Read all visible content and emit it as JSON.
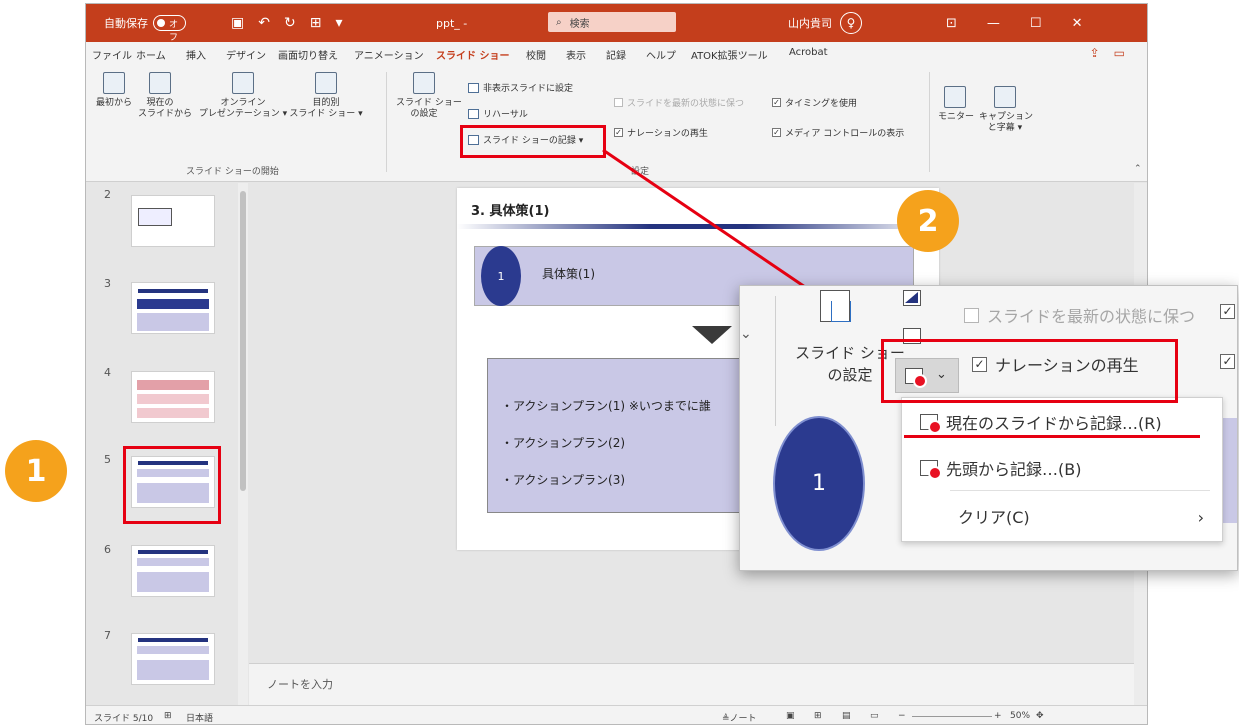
{
  "titlebar": {
    "autosave_label": "自動保存",
    "autosave_state": "オフ",
    "filename": "ppt_ -",
    "search_placeholder": "検索",
    "username": "山内貴司",
    "avatar_glyph": "♀"
  },
  "tabs": [
    "ファイル",
    "ホーム",
    "挿入",
    "デザイン",
    "画面切り替え",
    "アニメーション",
    "スライド ショー",
    "校閲",
    "表示",
    "記録",
    "ヘルプ",
    "ATOK拡張ツール",
    "Acrobat"
  ],
  "active_tab": "スライド ショー",
  "ribbon": {
    "from_start": "最初から",
    "from_current_1": "現在の",
    "from_current_2": "スライドから",
    "online_1": "オンライン",
    "online_2": "プレゼンテーション ▾",
    "custom_1": "目的別",
    "custom_2": "スライド ショー ▾",
    "group_start": "スライド ショーの開始",
    "setup_1": "スライド ショー",
    "setup_2": "の設定",
    "hide_slide": "非表示スライドに設定",
    "rehearse": "リハーサル",
    "record": "スライド ショーの記録 ▾",
    "keep_updated": "スライドを最新の状態に保つ",
    "play_narration": "ナレーションの再生",
    "use_timings": "タイミングを使用",
    "show_media": "メディア コントロールの表示",
    "group_setup": "設定",
    "monitor": "モニター",
    "captions_1": "キャプション",
    "captions_2": "と字幕 ▾"
  },
  "thumbnails": {
    "numbers": [
      "2",
      "3",
      "4",
      "5",
      "6",
      "7"
    ],
    "selected": "5"
  },
  "slide": {
    "title": "3. 具体策(1)",
    "circle_number": "1",
    "bar_text": "具体策(1)",
    "action_items": [
      "・アクションプラン(1)  ※いつまでに誰",
      "・アクションプラン(2)",
      "・アクションプラン(3)"
    ]
  },
  "notes_placeholder": "ノートを入力",
  "statusbar": {
    "slide_position": "スライド 5/10",
    "language": "日本語",
    "notes_button": "≜ノート",
    "zoom_minus": "−",
    "zoom_plus": "+",
    "zoom_level": "50%"
  },
  "zoom_popup": {
    "setup_label_1": "スライド ショー",
    "setup_label_2": "の設定",
    "keep_updated": "スライドを最新の状態に保つ",
    "play_narration": "ナレーションの再生",
    "menu_record_current": "現在のスライドから記録…(R)",
    "menu_record_start": "先頭から記録…(B)",
    "menu_clear": "クリア(C)",
    "circle_number": "1"
  },
  "callouts": {
    "step1": "1",
    "step2": "2"
  },
  "colors": {
    "office_accent": "#c43e1c",
    "highlight_red": "#e60012",
    "badge_orange": "#f5a21c",
    "slide_navy": "#2b3a8f",
    "slide_lavender": "#c9c8e6"
  }
}
